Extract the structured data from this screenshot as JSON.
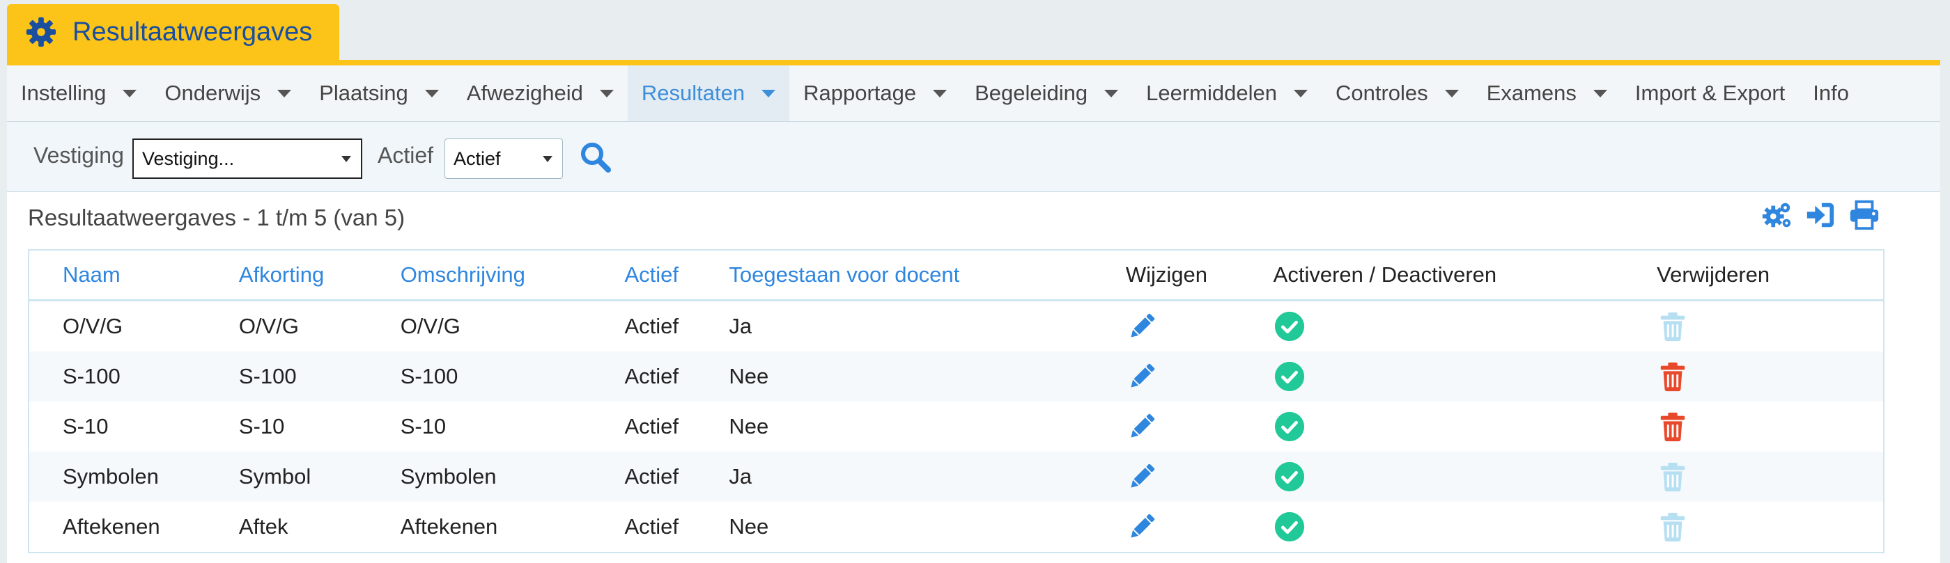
{
  "header": {
    "title": "Resultaatweergaves",
    "icon": "gear-icon",
    "accent": "#fcc419"
  },
  "menu": [
    {
      "label": "Instelling",
      "has_dropdown": true,
      "active": false
    },
    {
      "label": "Onderwijs",
      "has_dropdown": true,
      "active": false
    },
    {
      "label": "Plaatsing",
      "has_dropdown": true,
      "active": false
    },
    {
      "label": "Afwezigheid",
      "has_dropdown": true,
      "active": false
    },
    {
      "label": "Resultaten",
      "has_dropdown": true,
      "active": true
    },
    {
      "label": "Rapportage",
      "has_dropdown": true,
      "active": false
    },
    {
      "label": "Begeleiding",
      "has_dropdown": true,
      "active": false
    },
    {
      "label": "Leermiddelen",
      "has_dropdown": true,
      "active": false
    },
    {
      "label": "Controles",
      "has_dropdown": true,
      "active": false
    },
    {
      "label": "Examens",
      "has_dropdown": true,
      "active": false
    },
    {
      "label": "Import & Export",
      "has_dropdown": false,
      "active": false
    },
    {
      "label": "Info",
      "has_dropdown": false,
      "active": false
    }
  ],
  "filters": {
    "vestiging_label": "Vestiging",
    "vestiging_value": "Vestiging...",
    "actief_label": "Actief",
    "actief_value": "Actief",
    "search_icon": "search-icon"
  },
  "panel": {
    "title": "Resultaatweergaves - 1 t/m 5 (van 5)",
    "actions": [
      "cogs-icon",
      "sign-in-icon",
      "print-icon"
    ]
  },
  "table": {
    "columns": [
      "Naam",
      "Afkorting",
      "Omschrijving",
      "Actief",
      "Toegestaan voor docent",
      "Wijzigen",
      "Activeren / Deactiveren",
      "Verwijderen"
    ],
    "rows": [
      {
        "naam": "O/V/G",
        "afkorting": "O/V/G",
        "omschrijving": "O/V/G",
        "actief": "Actief",
        "toegestaan": "Ja",
        "delete_enabled": false
      },
      {
        "naam": "S-100",
        "afkorting": "S-100",
        "omschrijving": "S-100",
        "actief": "Actief",
        "toegestaan": "Nee",
        "delete_enabled": true
      },
      {
        "naam": "S-10",
        "afkorting": "S-10",
        "omschrijving": "S-10",
        "actief": "Actief",
        "toegestaan": "Nee",
        "delete_enabled": true
      },
      {
        "naam": "Symbolen",
        "afkorting": "Symbol",
        "omschrijving": "Symbolen",
        "actief": "Actief",
        "toegestaan": "Ja",
        "delete_enabled": false
      },
      {
        "naam": "Aftekenen",
        "afkorting": "Aftek",
        "omschrijving": "Aftekenen",
        "actief": "Actief",
        "toegestaan": "Nee",
        "delete_enabled": false
      }
    ]
  },
  "colors": {
    "link_blue": "#2e86de",
    "check_green": "#20c997",
    "delete_red": "#e8492b",
    "delete_disabled": "#b7dff2"
  }
}
